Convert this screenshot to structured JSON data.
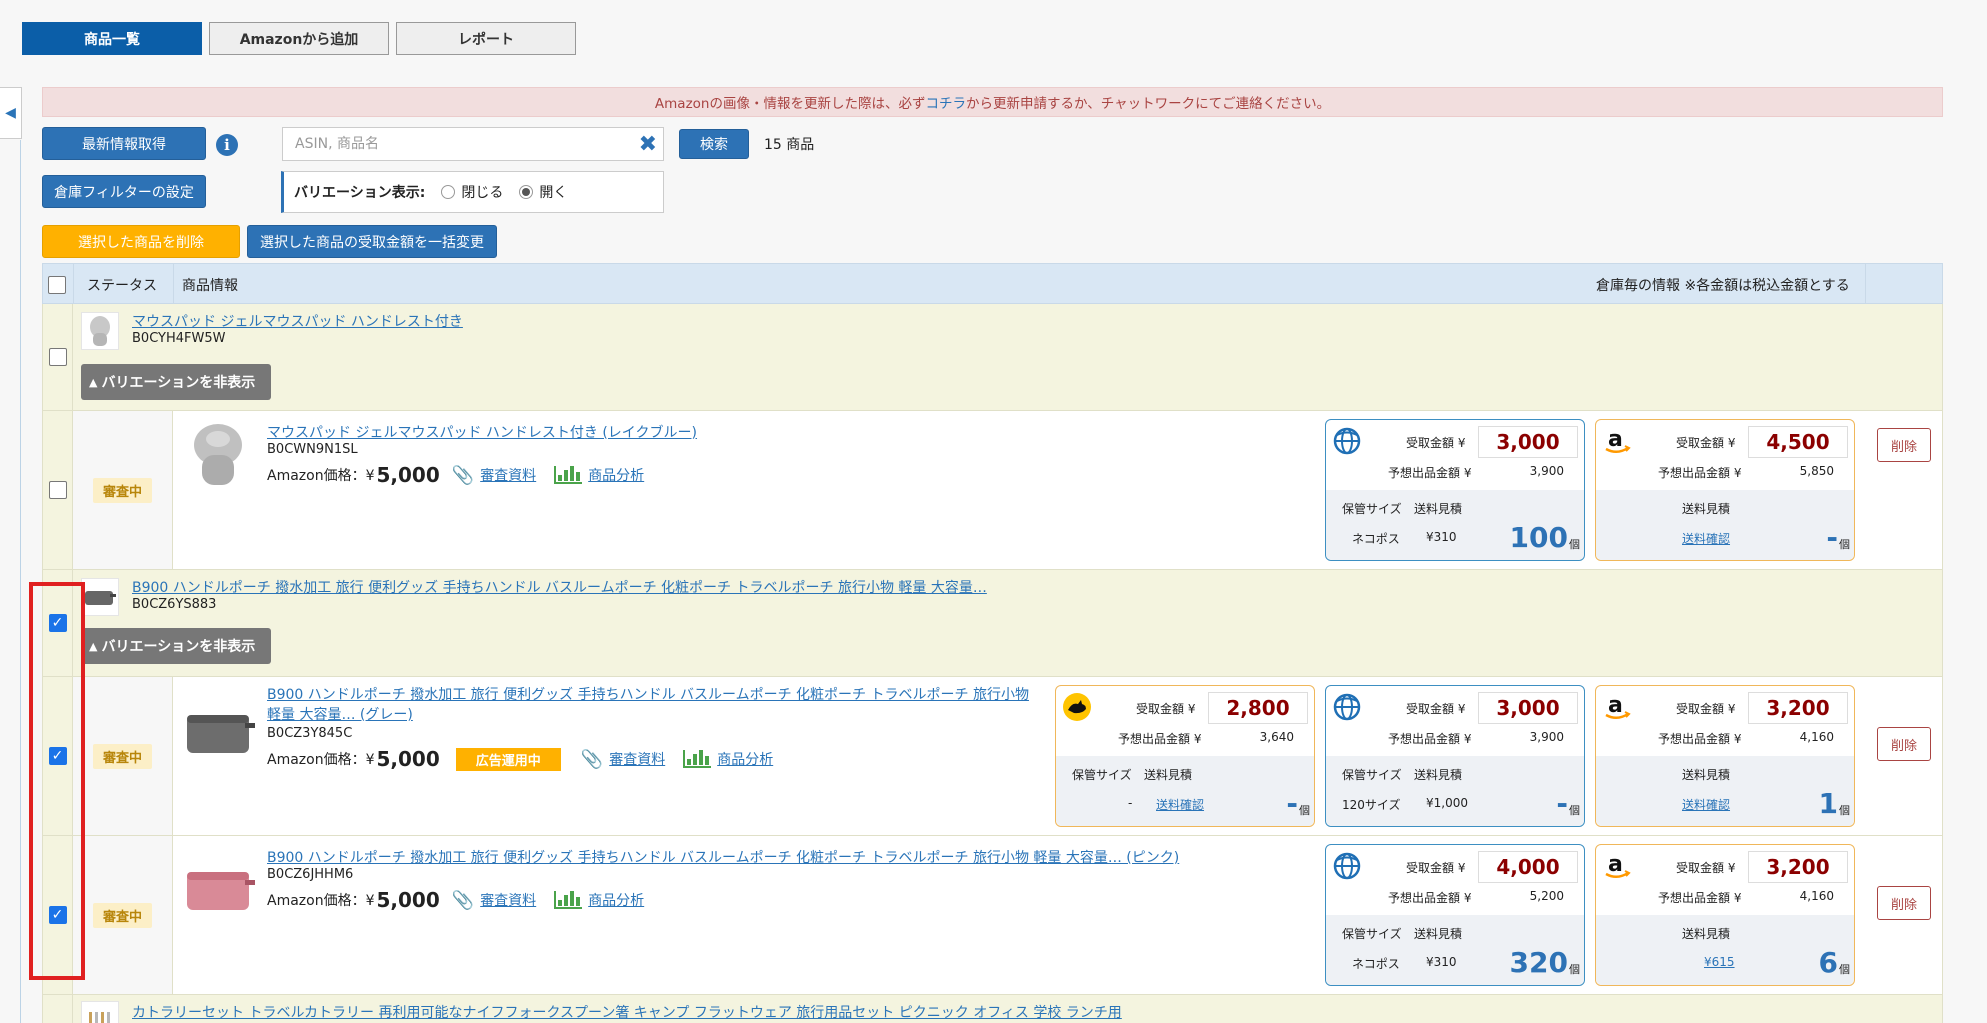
{
  "tabs": [
    {
      "label": "商品一覧",
      "active": true
    },
    {
      "label": "Amazonから追加",
      "active": false
    },
    {
      "label": "レポート",
      "active": false
    }
  ],
  "notice": {
    "before": "Amazonの画像・情報を更新した際は、必ず",
    "link": "コチラ",
    "after": "から更新申請するか、チャットワークにてご連絡ください。"
  },
  "toolbar": {
    "fetch_label": "最新情報取得",
    "search_placeholder": "ASIN, 商品名",
    "search_button": "検索",
    "count_text": "15 商品",
    "warehouse_filter": "倉庫フィルターの設定",
    "variation_label": "バリエーション表示:",
    "variation_options": [
      "閉じる",
      "開く"
    ],
    "variation_selected": "開く",
    "delete_selected": "選択した商品を削除",
    "bulk_change": "選択した商品の受取金額を一括変更"
  },
  "table_header": {
    "status": "ステータス",
    "product_info": "商品情報",
    "warehouse_info": "倉庫毎の情報 ※各金額は税込金額とする"
  },
  "labels": {
    "hide_variation": "バリエーションを非表示",
    "amazon_price": "Amazon価格：¥",
    "review_docs": "審査資料",
    "analysis": "商品分析",
    "receive_amount": "受取金額 ¥",
    "expected_amount": "予想出品金額 ¥",
    "storage_size": "保管サイズ",
    "shipping_estimate": "送料見積",
    "unit": "個",
    "delete": "削除",
    "ad_badge": "広告運用中",
    "reviewing": "審査中",
    "check_shipping": "送料確認"
  },
  "groups": [
    {
      "title": "マウスパッド ジェルマウスパッド ハンドレスト付き",
      "asin": "B0CYH4FW5W",
      "checked": false,
      "variations": [
        {
          "title": "マウスパッド ジェルマウスパッド ハンドレスト付き (レイクブルー)",
          "asin": "B0CWN9N1SL",
          "price": "5,000",
          "checked": false,
          "status": "審査中",
          "cards": [
            {
              "type": "globe",
              "receive": "3,000",
              "expected": "3,900",
              "size": "ネコポス",
              "ship": "¥310",
              "qty": "100"
            },
            {
              "type": "amazon",
              "receive": "4,500",
              "expected": "5,850",
              "ship": "送料確認",
              "qty": "-"
            }
          ]
        }
      ]
    },
    {
      "title": "B900 ハンドルポーチ 撥水加工 旅行 便利グッズ 手持ちハンドル バスルームポーチ 化粧ポーチ トラベルポーチ 旅行小物 軽量 大容量…",
      "asin": "B0CZ6YS883",
      "checked": true,
      "variations": [
        {
          "title_line1": "B900 ハンドルポーチ 撥水加工 旅行 便利グッズ 手持ちハンドル バスルームポーチ 化粧ポーチ トラベルポーチ 旅行小物",
          "title_line2": "軽量 大容量… (グレー)",
          "asin": "B0CZ3Y845C",
          "price": "5,000",
          "checked": true,
          "status": "審査中",
          "cards": [
            {
              "type": "yamato",
              "receive": "2,800",
              "expected": "3,640",
              "size": "-",
              "ship": "送料確認",
              "qty": "-"
            },
            {
              "type": "globe",
              "receive": "3,000",
              "expected": "3,900",
              "size": "120サイズ",
              "ship": "¥1,000",
              "qty": "-"
            },
            {
              "type": "amazon",
              "receive": "3,200",
              "expected": "4,160",
              "ship": "送料確認",
              "qty": "1"
            }
          ]
        },
        {
          "title": "B900 ハンドルポーチ 撥水加工 旅行 便利グッズ 手持ちハンドル バスルームポーチ 化粧ポーチ トラベルポーチ 旅行小物 軽量 大容量… (ピンク)",
          "asin": "B0CZ6JHHM6",
          "price": "5,000",
          "checked": true,
          "status": "審査中",
          "cards": [
            {
              "type": "globe",
              "receive": "4,000",
              "expected": "5,200",
              "size": "ネコポス",
              "ship": "¥310",
              "qty": "320"
            },
            {
              "type": "amazon",
              "receive": "3,200",
              "expected": "4,160",
              "ship": "¥615",
              "qty": "6"
            }
          ]
        }
      ]
    },
    {
      "title": "カトラリーセット トラベルカトラリー 再利用可能なナイフフォークスプーン箸 キャンプ フラットウェア 旅行用品セット ピクニック オフィス 学校 ランチ用"
    }
  ],
  "colors": {
    "primary": "#0b5ea8",
    "button": "#2d72b5",
    "warning": "#ffb100",
    "price": "#8b0000",
    "qty": "#2d72b5",
    "highlight": "#e02020"
  }
}
